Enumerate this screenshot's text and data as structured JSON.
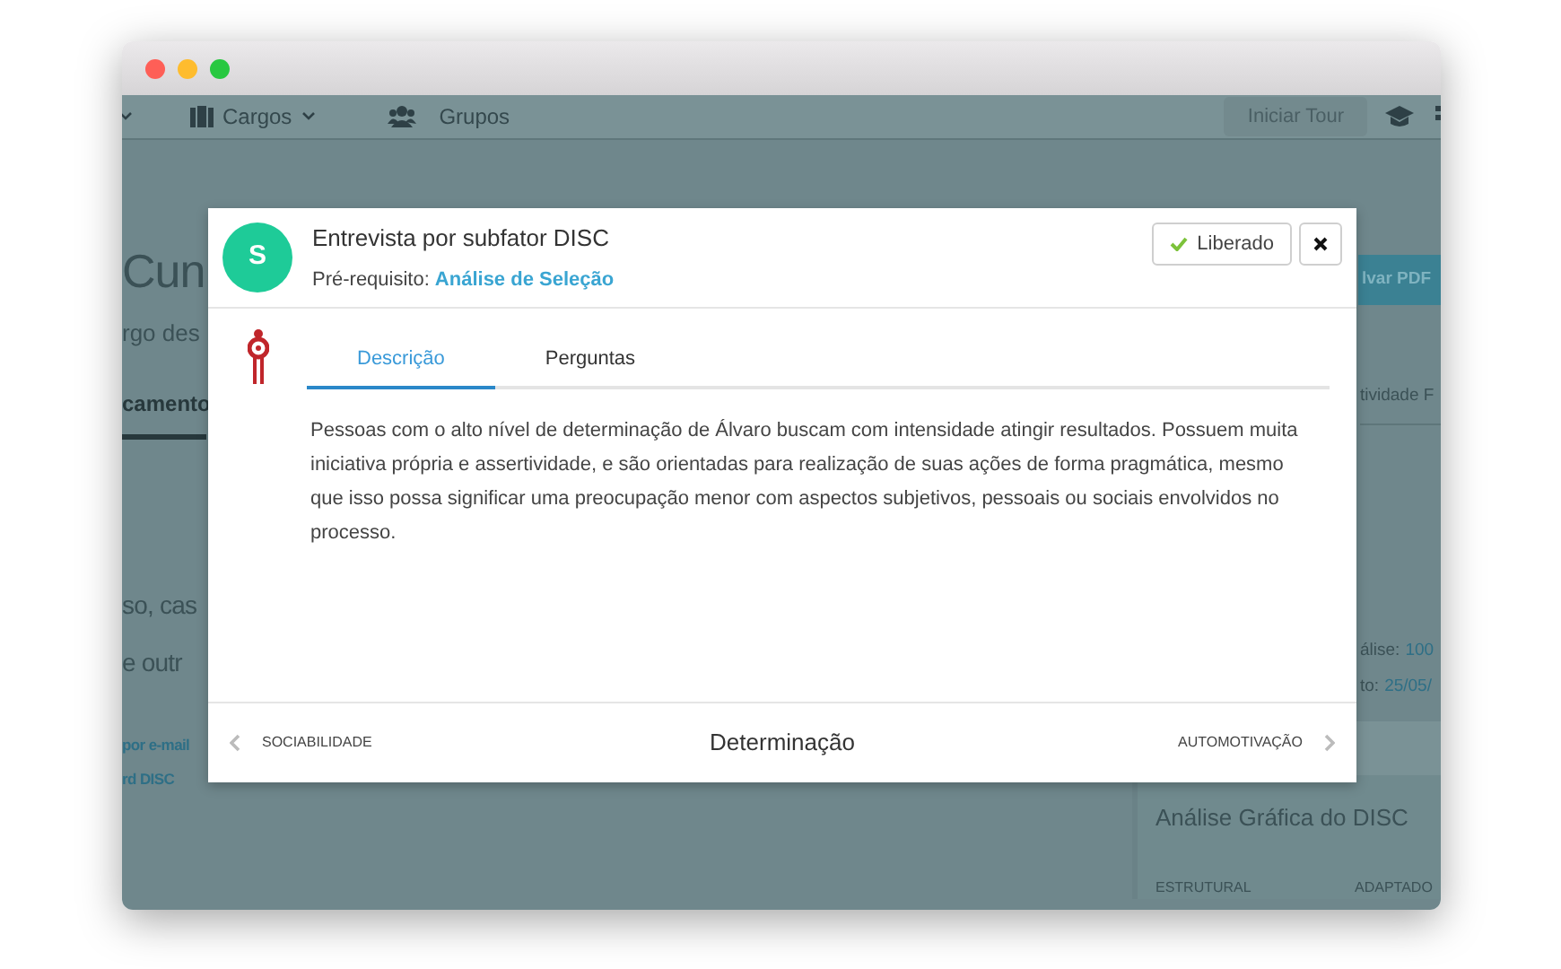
{
  "window": {
    "controls": [
      {
        "kind": "close"
      },
      {
        "kind": "minimize"
      },
      {
        "kind": "zoom"
      }
    ]
  },
  "nav": {
    "items": [
      {
        "label": "Cargos",
        "dropdown": true
      },
      {
        "label": "Grupos",
        "dropdown": false
      }
    ],
    "tour_button": "Iniciar Tour"
  },
  "page": {
    "heading": "Cun",
    "subtitle": "rgo des",
    "pdf_button": "lvar PDF",
    "left_tab": "camento",
    "right_tab": "tividade F",
    "body_lines": [
      "so, cas",
      "e outr"
    ],
    "links": [
      "por e-mail",
      "rd DISC"
    ],
    "info": [
      {
        "label": "álise:",
        "value": "100"
      },
      {
        "label": "to:",
        "value": "25/05/"
      }
    ],
    "panel": {
      "title": "Análise Gráfica do DISC",
      "columns": [
        "ESTRUTURAL",
        "ADAPTADO"
      ]
    }
  },
  "modal": {
    "avatar": "S",
    "title": "Entrevista por subfator DISC",
    "prerequisite_label": "Pré-requisito:",
    "prerequisite_link": "Análise de Seleção",
    "status_button": "Liberado",
    "tabs": [
      {
        "label": "Descrição",
        "selected": true
      },
      {
        "label": "Perguntas",
        "selected": false
      }
    ],
    "description": "Pessoas com o alto nível de determinação de Álvaro buscam com intensidade atingir resultados. Possuem muita iniciativa própria e assertividade, e são orientadas para realização de suas ações de forma pragmática, mesmo que isso possa significar uma preocupação menor com aspectos subjetivos, pessoais ou sociais envolvidos no processo.",
    "footer": {
      "previous": "SOCIABILIDADE",
      "current": "Determinação",
      "next": "AUTOMOTIVAÇÃO"
    }
  }
}
